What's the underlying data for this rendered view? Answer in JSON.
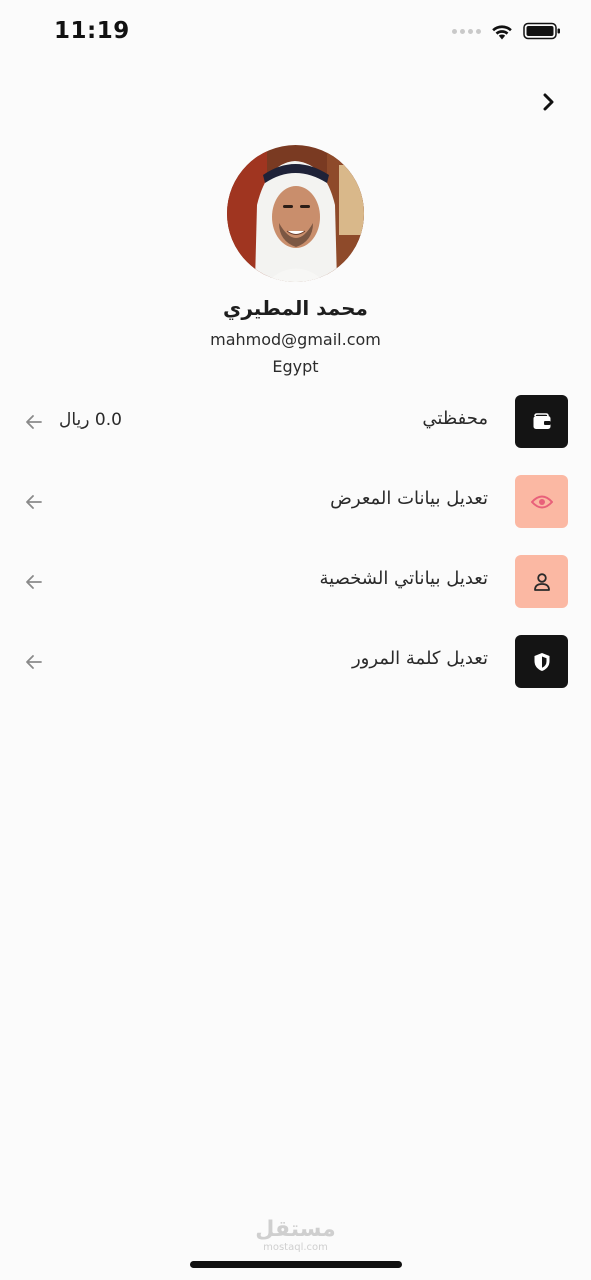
{
  "status_bar": {
    "time": "11:19"
  },
  "profile": {
    "name": "محمد المطيري",
    "email": "mahmod@gmail.com",
    "country": "Egypt"
  },
  "menu": {
    "items": [
      {
        "label": "محفظتي",
        "value": "0.0 ريال",
        "icon": "wallet-icon",
        "icon_bg": "#141414"
      },
      {
        "label": "تعديل بيانات المعرض",
        "value": "",
        "icon": "eye-icon",
        "icon_bg": "#fbb8a3"
      },
      {
        "label": "تعديل بياناتي الشخصية",
        "value": "",
        "icon": "user-icon",
        "icon_bg": "#fbb8a3"
      },
      {
        "label": "تعديل كلمة المرور",
        "value": "",
        "icon": "shield-icon",
        "icon_bg": "#141414"
      }
    ]
  },
  "watermark": {
    "main": "مستقل",
    "sub": "mostaql.com"
  },
  "colors": {
    "background": "#fbfbfb",
    "dark_icon_bg": "#141414",
    "peach_icon_bg": "#fbb8a3",
    "eye_icon": "#e8607a"
  }
}
